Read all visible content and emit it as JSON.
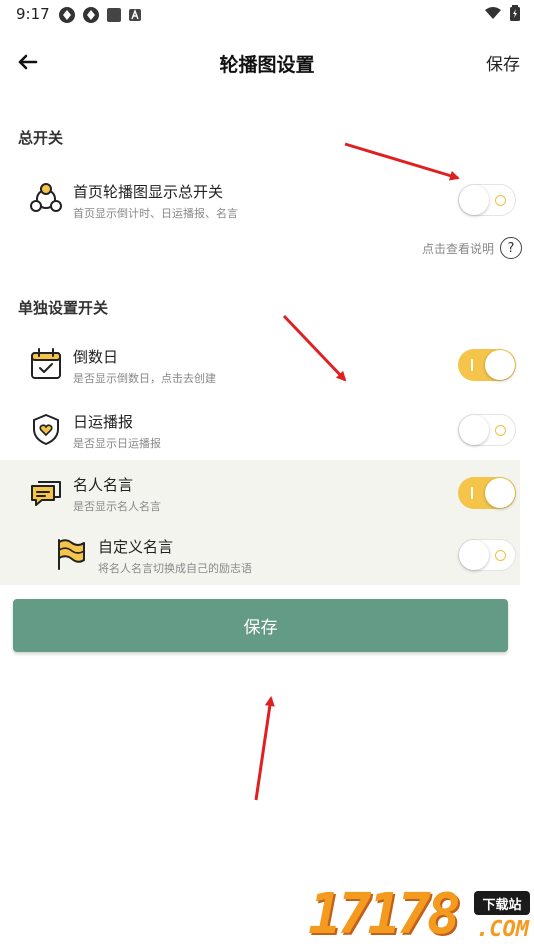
{
  "status_bar": {
    "time": "9:17"
  },
  "app_bar": {
    "title": "轮播图设置",
    "save_label": "保存"
  },
  "sections": {
    "master_title": "总开关",
    "individual_title": "单独设置开关"
  },
  "master": {
    "title": "首页轮播图显示总开关",
    "subtitle": "首页显示倒计时、日运播报、名言",
    "enabled": false
  },
  "help": {
    "text": "点击查看说明",
    "icon_glyph": "?"
  },
  "items": [
    {
      "title": "倒数日",
      "subtitle": "是否显示倒数日，点击去创建",
      "enabled": true,
      "icon": "calendar-icon"
    },
    {
      "title": "日运播报",
      "subtitle": "是否显示日运播报",
      "enabled": false,
      "icon": "shield-heart-icon"
    },
    {
      "title": "名人名言",
      "subtitle": "是否显示名人名言",
      "enabled": true,
      "icon": "chat-bubbles-icon"
    },
    {
      "title": "自定义名言",
      "subtitle": "将名人名言切换成自己的励志语",
      "enabled": false,
      "icon": "flag-icon"
    }
  ],
  "save_button": {
    "label": "保存"
  },
  "watermark": {
    "digits": "17178",
    "badge": "下载站",
    "suffix": ".COM"
  },
  "colors": {
    "accent": "#649b86",
    "toggle_on": "#f4c54a",
    "icon_yellow": "#f4c54a",
    "arrow_red": "#e02020"
  }
}
